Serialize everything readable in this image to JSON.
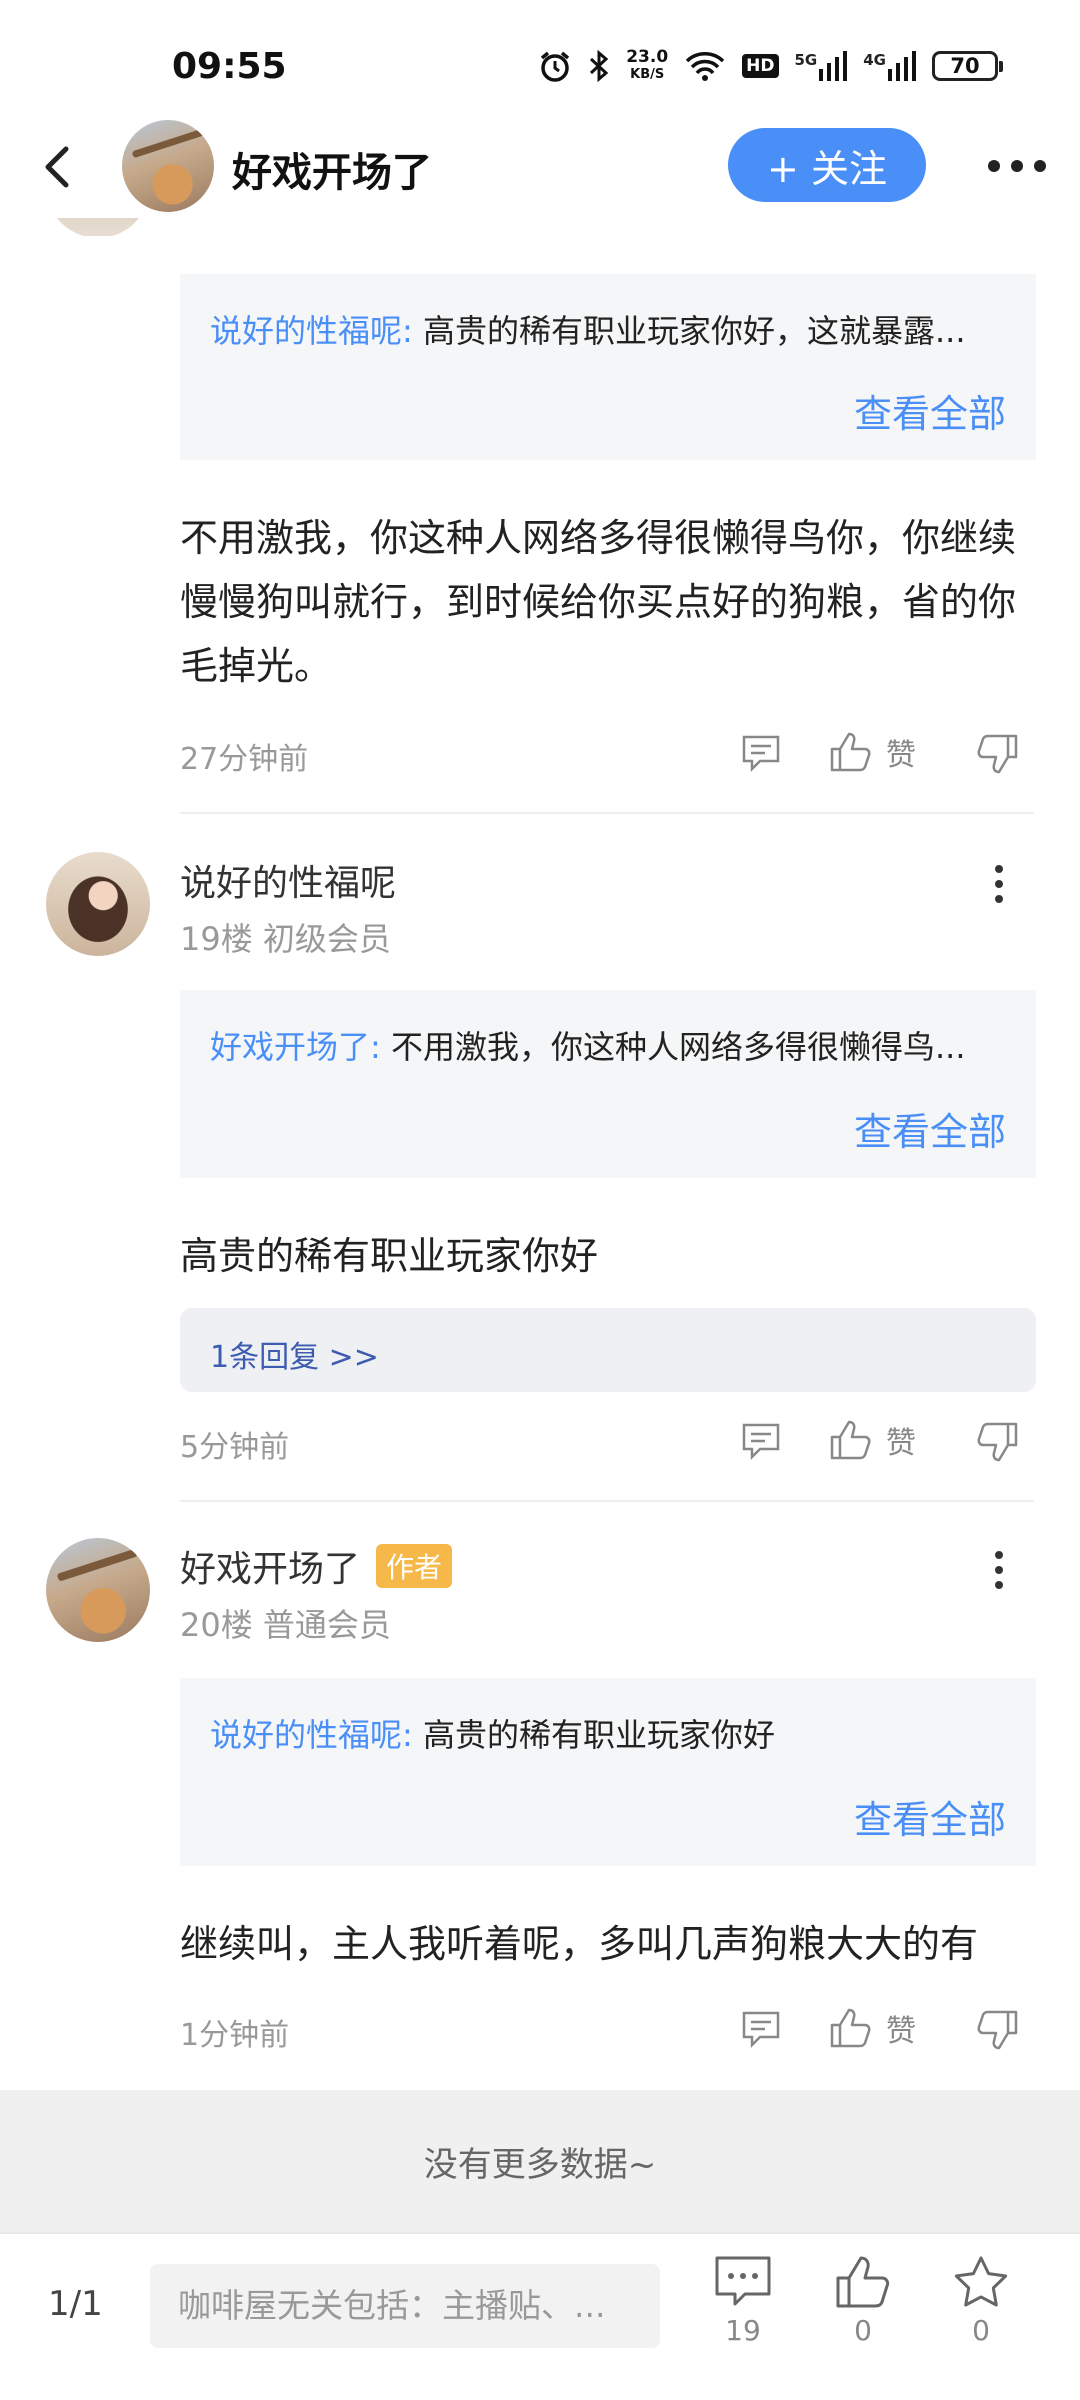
{
  "status_bar": {
    "time": "09:55",
    "net_speed_value": "23.0",
    "net_speed_unit": "KB/S",
    "hd_label": "HD",
    "signal1_label": "5G",
    "signal2_label": "4G",
    "battery": "70"
  },
  "header": {
    "title": "好戏开场了",
    "follow_label": "+ 关注"
  },
  "comments": [
    {
      "quote_author": "说好的性福呢:",
      "quote_text": "高贵的稀有职业玩家你好，这就暴露...",
      "view_all": "查看全部",
      "text": "不用激我，你这种人网络多得很懒得鸟你，你继续慢慢狗叫就行，到时候给你买点好的狗粮，省的你毛掉光。",
      "time": "27分钟前",
      "like_label": "赞"
    },
    {
      "user": "说好的性福呢",
      "level": "19楼 初级会员",
      "quote_author": "好戏开场了:",
      "quote_text": "不用激我，你这种人网络多得很懒得鸟...",
      "view_all": "查看全部",
      "text": "高贵的稀有职业玩家你好",
      "replies": "1条回复 >>",
      "time": "5分钟前",
      "like_label": "赞"
    },
    {
      "user": "好戏开场了",
      "badge": "作者",
      "level": "20楼 普通会员",
      "quote_author": "说好的性福呢:",
      "quote_text": "高贵的稀有职业玩家你好",
      "view_all": "查看全部",
      "text": "继续叫，主人我听着呢，多叫几声狗粮大大的有",
      "time": "1分钟前",
      "like_label": "赞"
    }
  ],
  "footer_note": "没有更多数据~",
  "bottom_bar": {
    "page": "1/1",
    "input_placeholder": "咖啡屋无关包括：主播贴、...",
    "comment_count": "19",
    "like_count": "0",
    "star_count": "0"
  }
}
